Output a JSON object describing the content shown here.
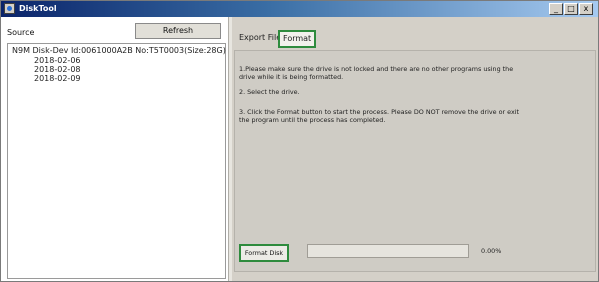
{
  "window": {
    "title": "DiskTool",
    "controls": {
      "minimize": "_",
      "maximize": "□",
      "close": "x"
    }
  },
  "source": {
    "label": "Source",
    "refresh_label": "Refresh",
    "tree": {
      "root": "N9M Disk-Dev Id:0061000A2B No:T5T0003(Size:28G)",
      "children": [
        "2018-02-06",
        "2018-02-08",
        "2018-02-09"
      ]
    }
  },
  "tabs": [
    {
      "label": "Export File",
      "active": false
    },
    {
      "label": "Format",
      "active": true
    }
  ],
  "format_panel": {
    "instructions": [
      "1.Please make sure the drive is not locked and there are no other programs using the drive while it is being formatted.",
      "2. Select the drive.",
      "3. Click the Format button to start the process. Please DO NOT remove the drive or exit the program until the process has completed."
    ],
    "format_button_label": "Format Disk",
    "progress_fraction": 0,
    "progress_text": "0.00%"
  },
  "colors": {
    "highlight": "#2e8b3d",
    "titlebar": "#0a246a"
  }
}
